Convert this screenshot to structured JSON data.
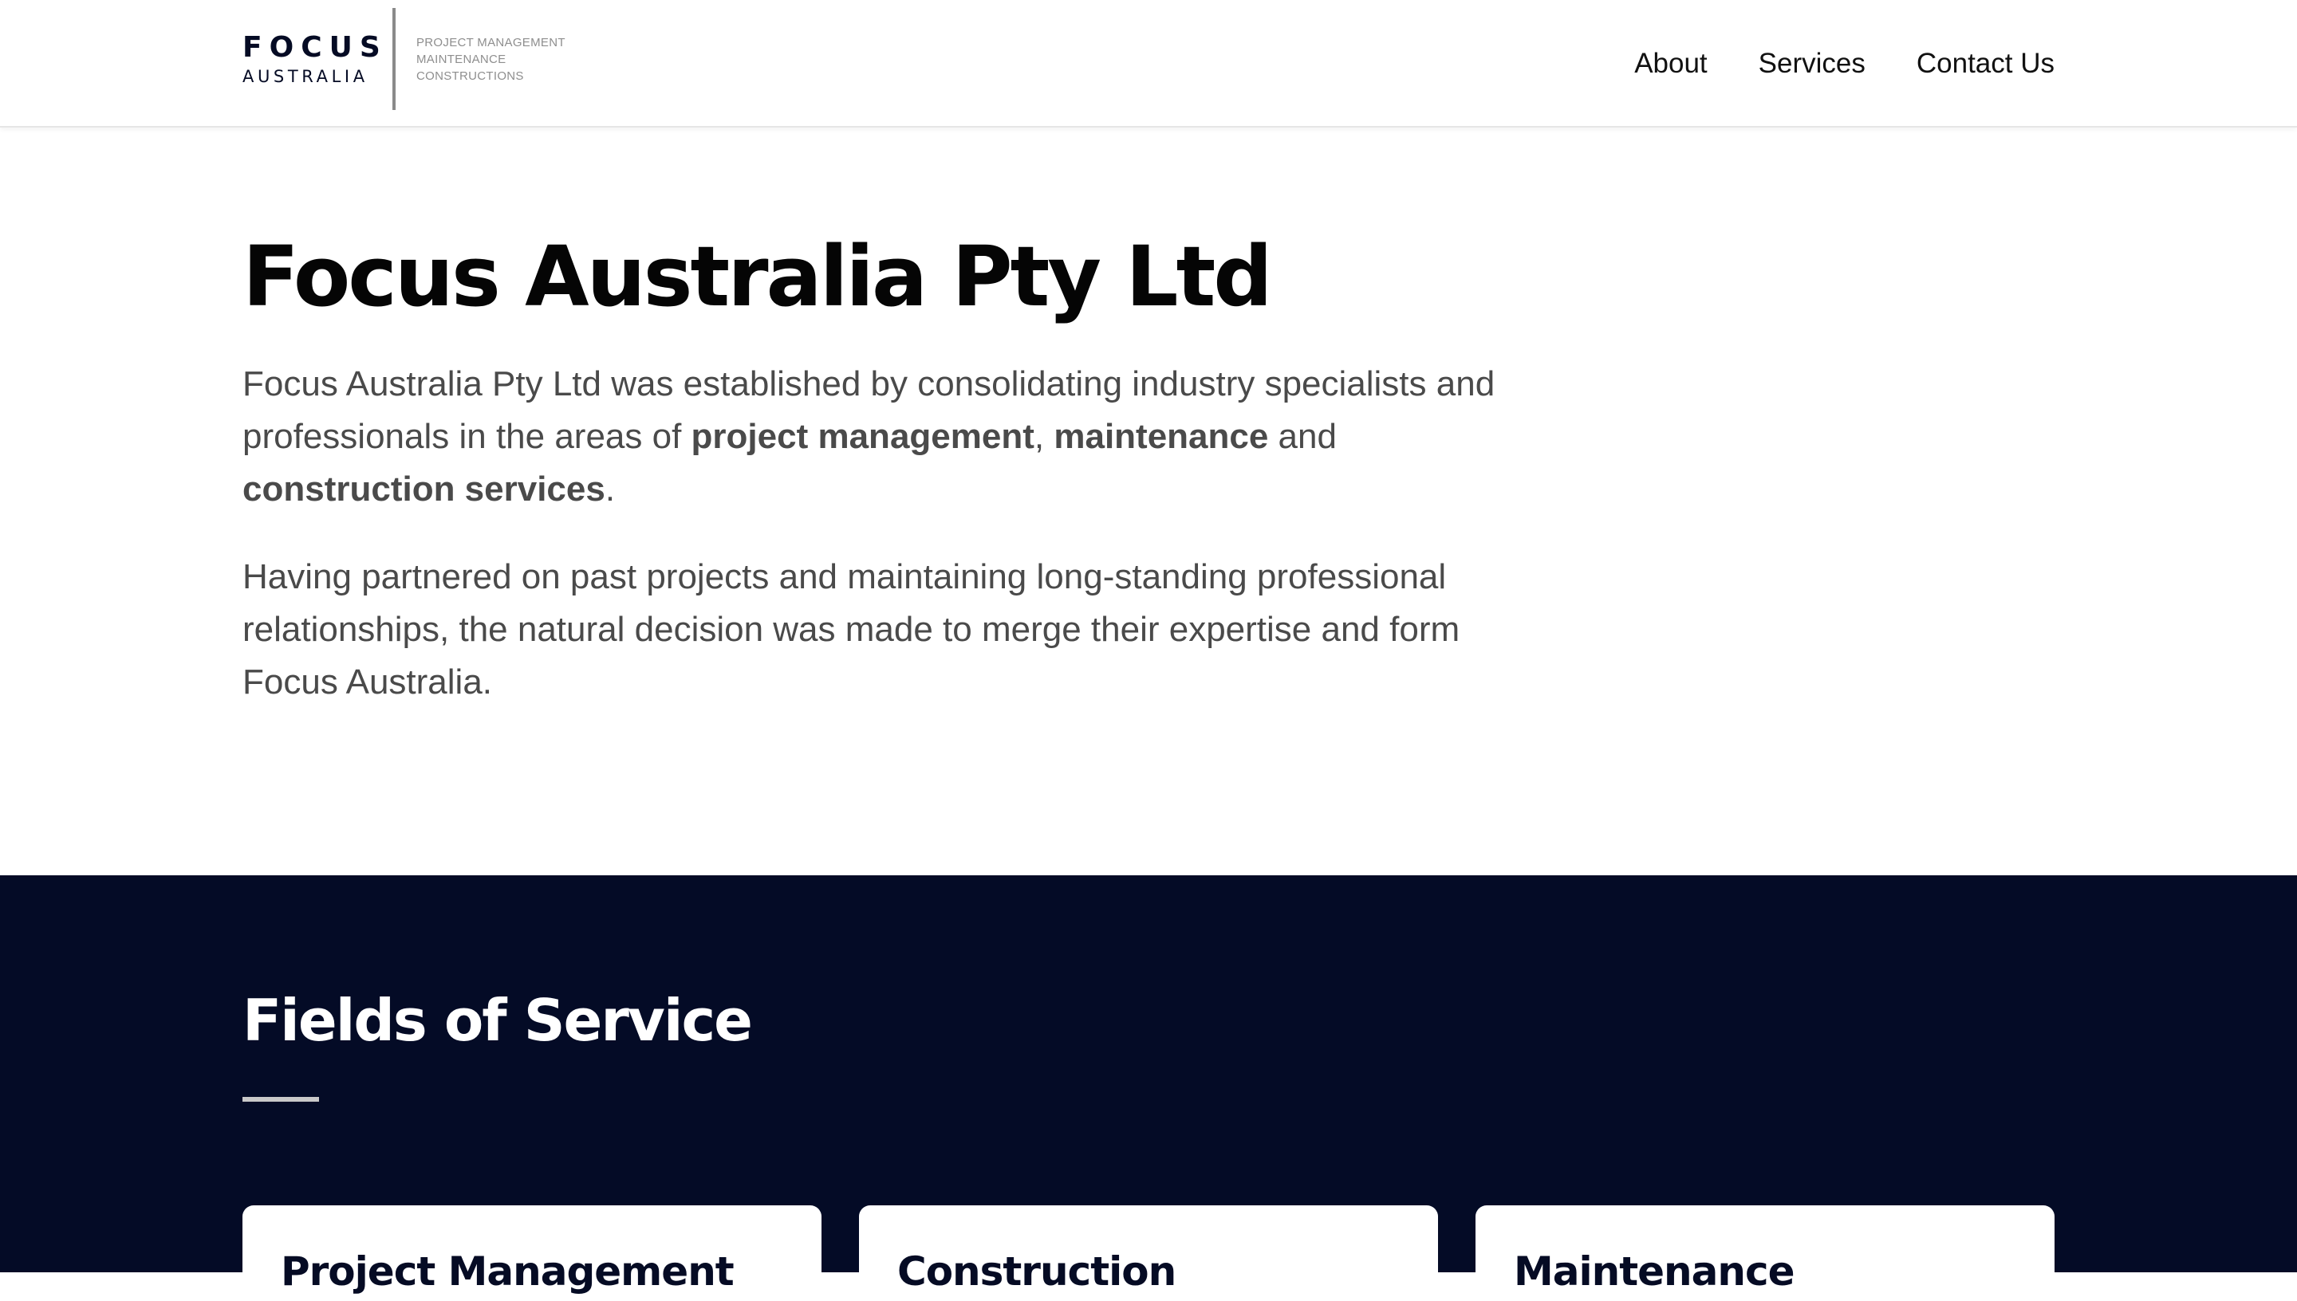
{
  "header": {
    "logo": {
      "word1": "FOCUS",
      "word2": "AUSTRALIA",
      "tagline": [
        "PROJECT MANAGEMENT",
        "MAINTENANCE",
        "CONSTRUCTIONS"
      ]
    },
    "nav": [
      {
        "label": "About"
      },
      {
        "label": "Services"
      },
      {
        "label": "Contact Us"
      }
    ]
  },
  "about": {
    "title": "Focus Australia Pty Ltd",
    "paragraph1": {
      "intro": "Focus Australia Pty Ltd was established by consolidating industry specialists and professionals in the areas of ",
      "term1": "project management",
      "sep1": ", ",
      "term2": "maintenance",
      "sep2": " and ",
      "term3": "construction services",
      "end": "."
    },
    "paragraph2": "Having partnered on past projects and maintaining long-standing professional relationships, the natural decision was made to merge their expertise and form Focus Australia."
  },
  "services": {
    "title": "Fields of Service",
    "cards": [
      {
        "title": "Project Management"
      },
      {
        "title": "Construction"
      },
      {
        "title": "Maintenance"
      }
    ]
  },
  "colors": {
    "navy": "#040b26",
    "body_text": "#4a4a4a",
    "tagline_gray": "#8e8e8e"
  }
}
